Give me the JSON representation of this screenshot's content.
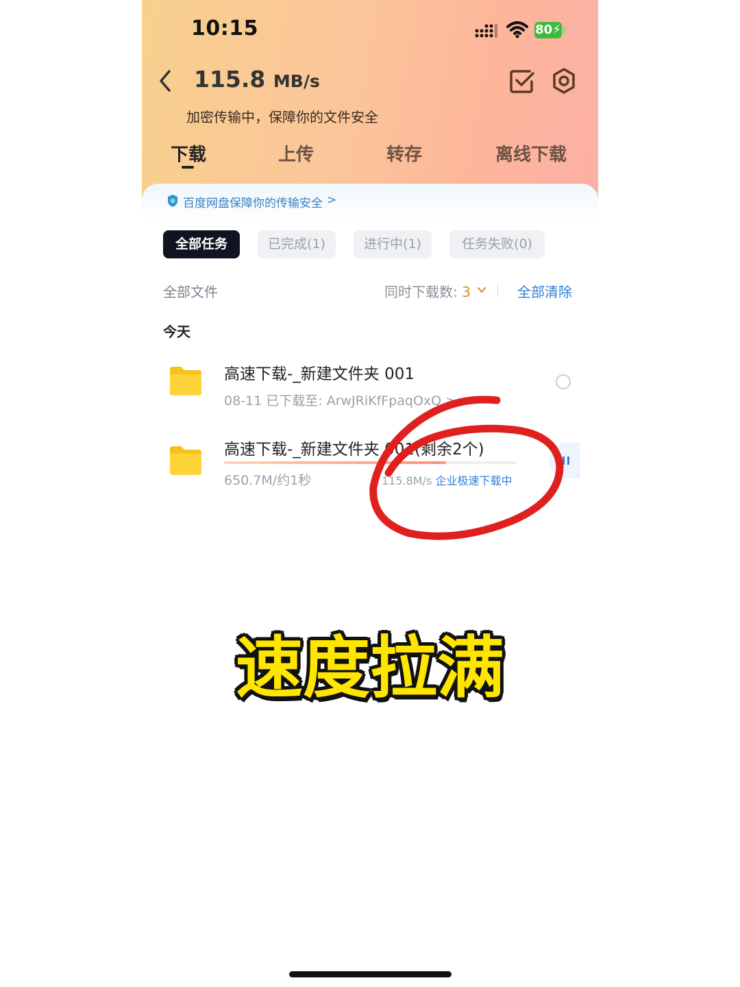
{
  "status_bar": {
    "time": "10:15",
    "battery": "80",
    "icons": [
      "signal-icon",
      "wifi-icon",
      "battery-charging-icon"
    ]
  },
  "header": {
    "speed_value": "115.8",
    "speed_unit": "MB/s",
    "subtitle": "加密传输中，保障你的文件安全",
    "icons": [
      "back-icon",
      "select-check-icon",
      "settings-gear-icon"
    ]
  },
  "tabs": [
    {
      "label": "下载",
      "active": true
    },
    {
      "label": "上传",
      "active": false
    },
    {
      "label": "转存",
      "active": false
    },
    {
      "label": "离线下载",
      "active": false
    }
  ],
  "security_notice": {
    "text": "百度网盘保障你的传输安全",
    "chevron": ">"
  },
  "filters": [
    {
      "label": "全部任务",
      "active": true
    },
    {
      "label": "已完成(1)",
      "active": false
    },
    {
      "label": "进行中(1)",
      "active": false
    },
    {
      "label": "任务失败(0)",
      "active": false
    }
  ],
  "toolbar": {
    "all_files": "全部文件",
    "concurrent_label": "同时下载数:",
    "concurrent_value": "3",
    "clear_all": "全部清除"
  },
  "section_today": "今天",
  "tasks": [
    {
      "name": "高速下载-_新建文件夹 001",
      "meta": "08-11  已下载至: ArwJRiKfFpaqOxQ >",
      "status": "completed"
    },
    {
      "name": "高速下载-_新建文件夹 001(剩余2个)",
      "meta": "650.7M/约1秒",
      "speed": "115.8M/s",
      "speed_label": "企业极速下载中",
      "progress": 0.76,
      "status": "downloading"
    }
  ],
  "overlay_caption": "速度拉满",
  "colors": {
    "accent_blue": "#2f7fd8",
    "annotation_red": "#e01f1f",
    "caption_yellow": "#ffe600"
  }
}
